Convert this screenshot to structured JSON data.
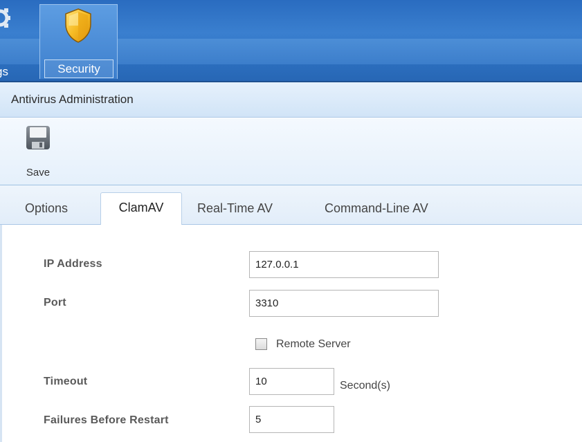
{
  "ribbon": {
    "items": [
      {
        "label": "gs",
        "icon": "gear-icon"
      },
      {
        "label": "Security",
        "icon": "shield-icon",
        "selected": true
      }
    ]
  },
  "panel": {
    "title": "Antivirus Administration"
  },
  "toolbar": {
    "save_label": "Save",
    "save_icon": "floppy-disk-icon"
  },
  "tabs": [
    {
      "label": "Options",
      "active": false
    },
    {
      "label": "ClamAV",
      "active": true
    },
    {
      "label": "Real-Time AV",
      "active": false
    },
    {
      "label": "Command-Line AV",
      "active": false
    }
  ],
  "form": {
    "ip_address": {
      "label": "IP Address",
      "value": "127.0.0.1"
    },
    "port": {
      "label": "Port",
      "value": "3310"
    },
    "remote_server": {
      "label": "Remote Server",
      "checked": false
    },
    "timeout": {
      "label": "Timeout",
      "value": "10",
      "unit": "Second(s)"
    },
    "failures_before_restart": {
      "label": "Failures Before Restart",
      "value": "5"
    }
  },
  "colors": {
    "ribbon": "#2c6fbf",
    "titlebar": "#d1e4f7",
    "shield": "#f3b51c"
  }
}
